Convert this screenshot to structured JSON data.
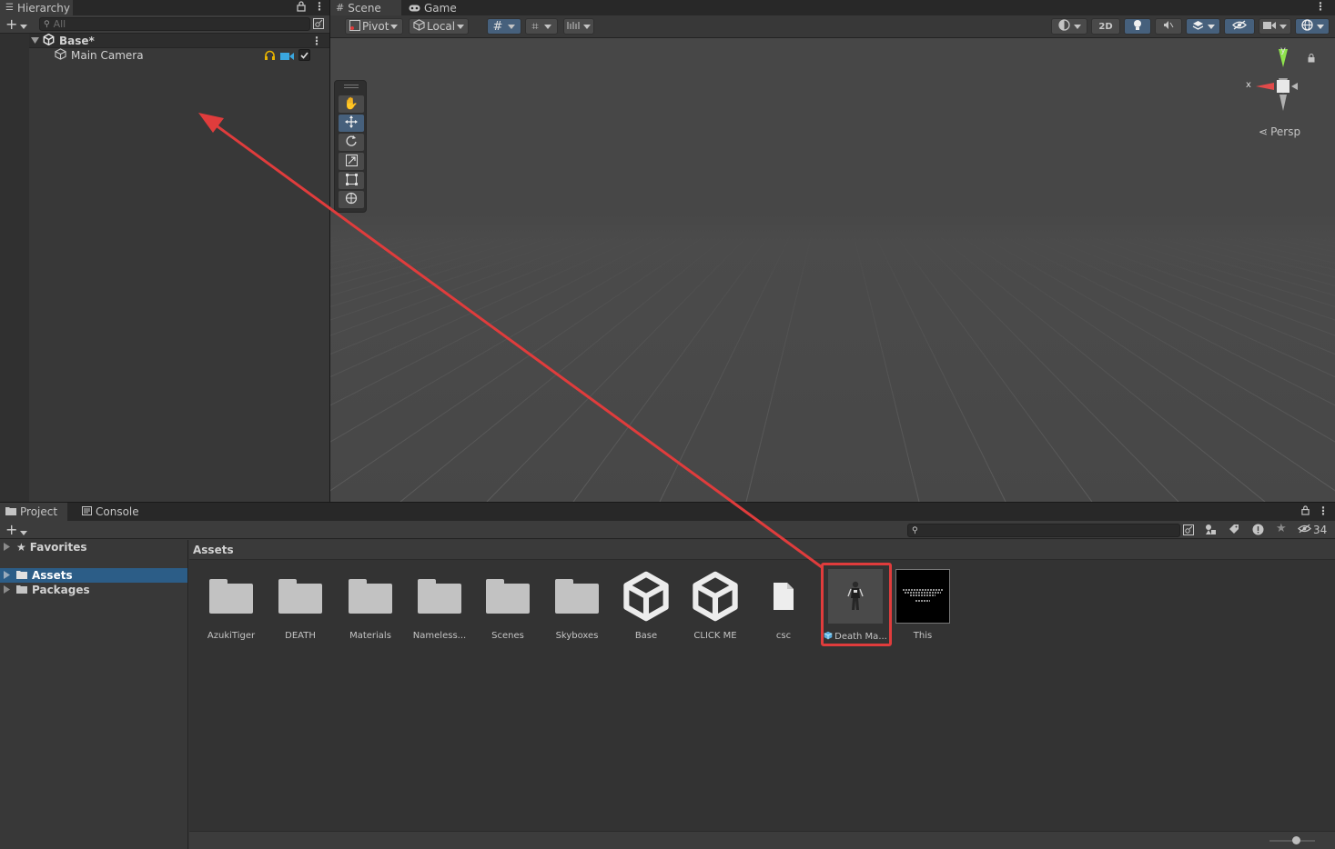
{
  "hierarchy": {
    "tab_label": "Hierarchy",
    "search_placeholder": "All",
    "scene_name": "Base*",
    "items": [
      {
        "label": "Main Camera"
      }
    ]
  },
  "scene": {
    "tabs": [
      {
        "label": "Scene"
      },
      {
        "label": "Game"
      }
    ],
    "pivot_label": "Pivot",
    "local_label": "Local",
    "twod_label": "2D",
    "persp_label": "Persp",
    "gizmo_x": "x",
    "gizmo_y": "y"
  },
  "project": {
    "tabs": [
      {
        "label": "Project"
      },
      {
        "label": "Console"
      }
    ],
    "hidden_count": "34",
    "tree": [
      {
        "label": "Favorites"
      },
      {
        "label": "Assets"
      },
      {
        "label": "Packages"
      }
    ],
    "breadcrumb": "Assets",
    "assets": [
      {
        "label": "AzukiTiger",
        "kind": "folder"
      },
      {
        "label": "DEATH",
        "kind": "folder"
      },
      {
        "label": "Materials",
        "kind": "folder"
      },
      {
        "label": "Nameless...",
        "kind": "folder"
      },
      {
        "label": "Scenes",
        "kind": "folder"
      },
      {
        "label": "Skyboxes",
        "kind": "folder"
      },
      {
        "label": "Base",
        "kind": "unity-scene"
      },
      {
        "label": "CLICK ME",
        "kind": "unity-scene"
      },
      {
        "label": "csc",
        "kind": "file"
      },
      {
        "label": "Death Ma...",
        "kind": "prefab"
      },
      {
        "label": "This",
        "kind": "image"
      }
    ]
  },
  "colors": {
    "selection": "#2c5d87",
    "highlight": "#e03c3c",
    "arrow": "#e03c3c"
  }
}
